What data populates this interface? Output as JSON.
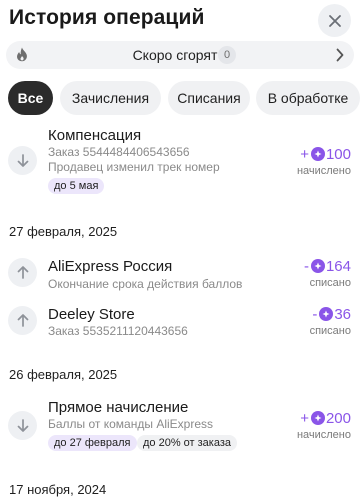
{
  "header": {
    "title": "История операций"
  },
  "expiring": {
    "label": "Скоро сгорят",
    "count": "0"
  },
  "tabs": [
    {
      "label": "Все"
    },
    {
      "label": "Зачисления"
    },
    {
      "label": "Списания"
    },
    {
      "label": "В обработке"
    }
  ],
  "transactions_top": [
    {
      "name": "Компенсация",
      "lines": [
        "Заказ 5544484406543656",
        "Продавец изменил трек номер"
      ],
      "tags": [
        "до 5 мая"
      ],
      "amount_sign": "+",
      "amount": "100",
      "status": "начислено",
      "direction": "in"
    }
  ],
  "groups": [
    {
      "date": "27 февраля, 2025",
      "items": [
        {
          "name": "AliExpress Россия",
          "lines": [
            "Окончание срока действия баллов"
          ],
          "amount_sign": "-",
          "amount": "164",
          "status": "списано",
          "direction": "out"
        },
        {
          "name": "Deeley Store",
          "lines": [
            "Заказ 5535211120443656"
          ],
          "amount_sign": "-",
          "amount": "36",
          "status": "списано",
          "direction": "out"
        }
      ]
    },
    {
      "date": "26 февраля, 2025",
      "items": [
        {
          "name": "Прямое начисление",
          "lines": [
            "Баллы от команды AliExpress"
          ],
          "tags": [
            "до 27 февраля",
            "до 20% от заказа"
          ],
          "amount_sign": "+",
          "amount": "200",
          "status": "начислено",
          "direction": "in"
        }
      ]
    },
    {
      "date": "17 ноября, 2024",
      "items": []
    }
  ],
  "colors": {
    "accent": "#8a55e8",
    "active_tab": "#2b2b2b",
    "chip_bg": "#f0f1f3",
    "tag_purple": "#ece6fb"
  },
  "icons": {
    "close": "close-icon",
    "fire": "fire-icon",
    "chevron": "chevron-right-icon",
    "arrow_in": "arrow-down-icon",
    "arrow_out": "arrow-up-icon",
    "coin": "points-coin-icon"
  }
}
